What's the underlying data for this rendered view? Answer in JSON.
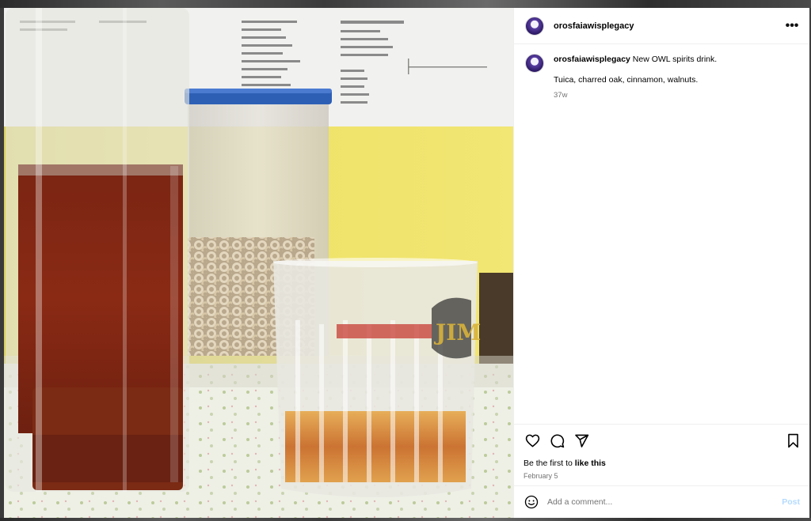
{
  "post": {
    "username": "orosfaiawisplegacy",
    "caption_text": "New OWL spirits drink.",
    "caption_line2": "Tuica, charred oak, cinnamon, walnuts.",
    "caption_time": "37w",
    "likes_prefix": "Be the first to ",
    "likes_link": "like this",
    "date": "February 5"
  },
  "comment": {
    "placeholder": "Add a comment...",
    "post_label": "Post"
  },
  "header": {
    "more_label": "•••"
  },
  "icons": {
    "more": "more-options-icon",
    "like": "heart-icon",
    "comment": "comment-icon",
    "share": "share-icon",
    "save": "bookmark-icon",
    "emoji": "emoji-icon"
  },
  "colors": {
    "post_button": "#b3dbff",
    "secondary_text": "#737373",
    "divider": "#efefef"
  }
}
